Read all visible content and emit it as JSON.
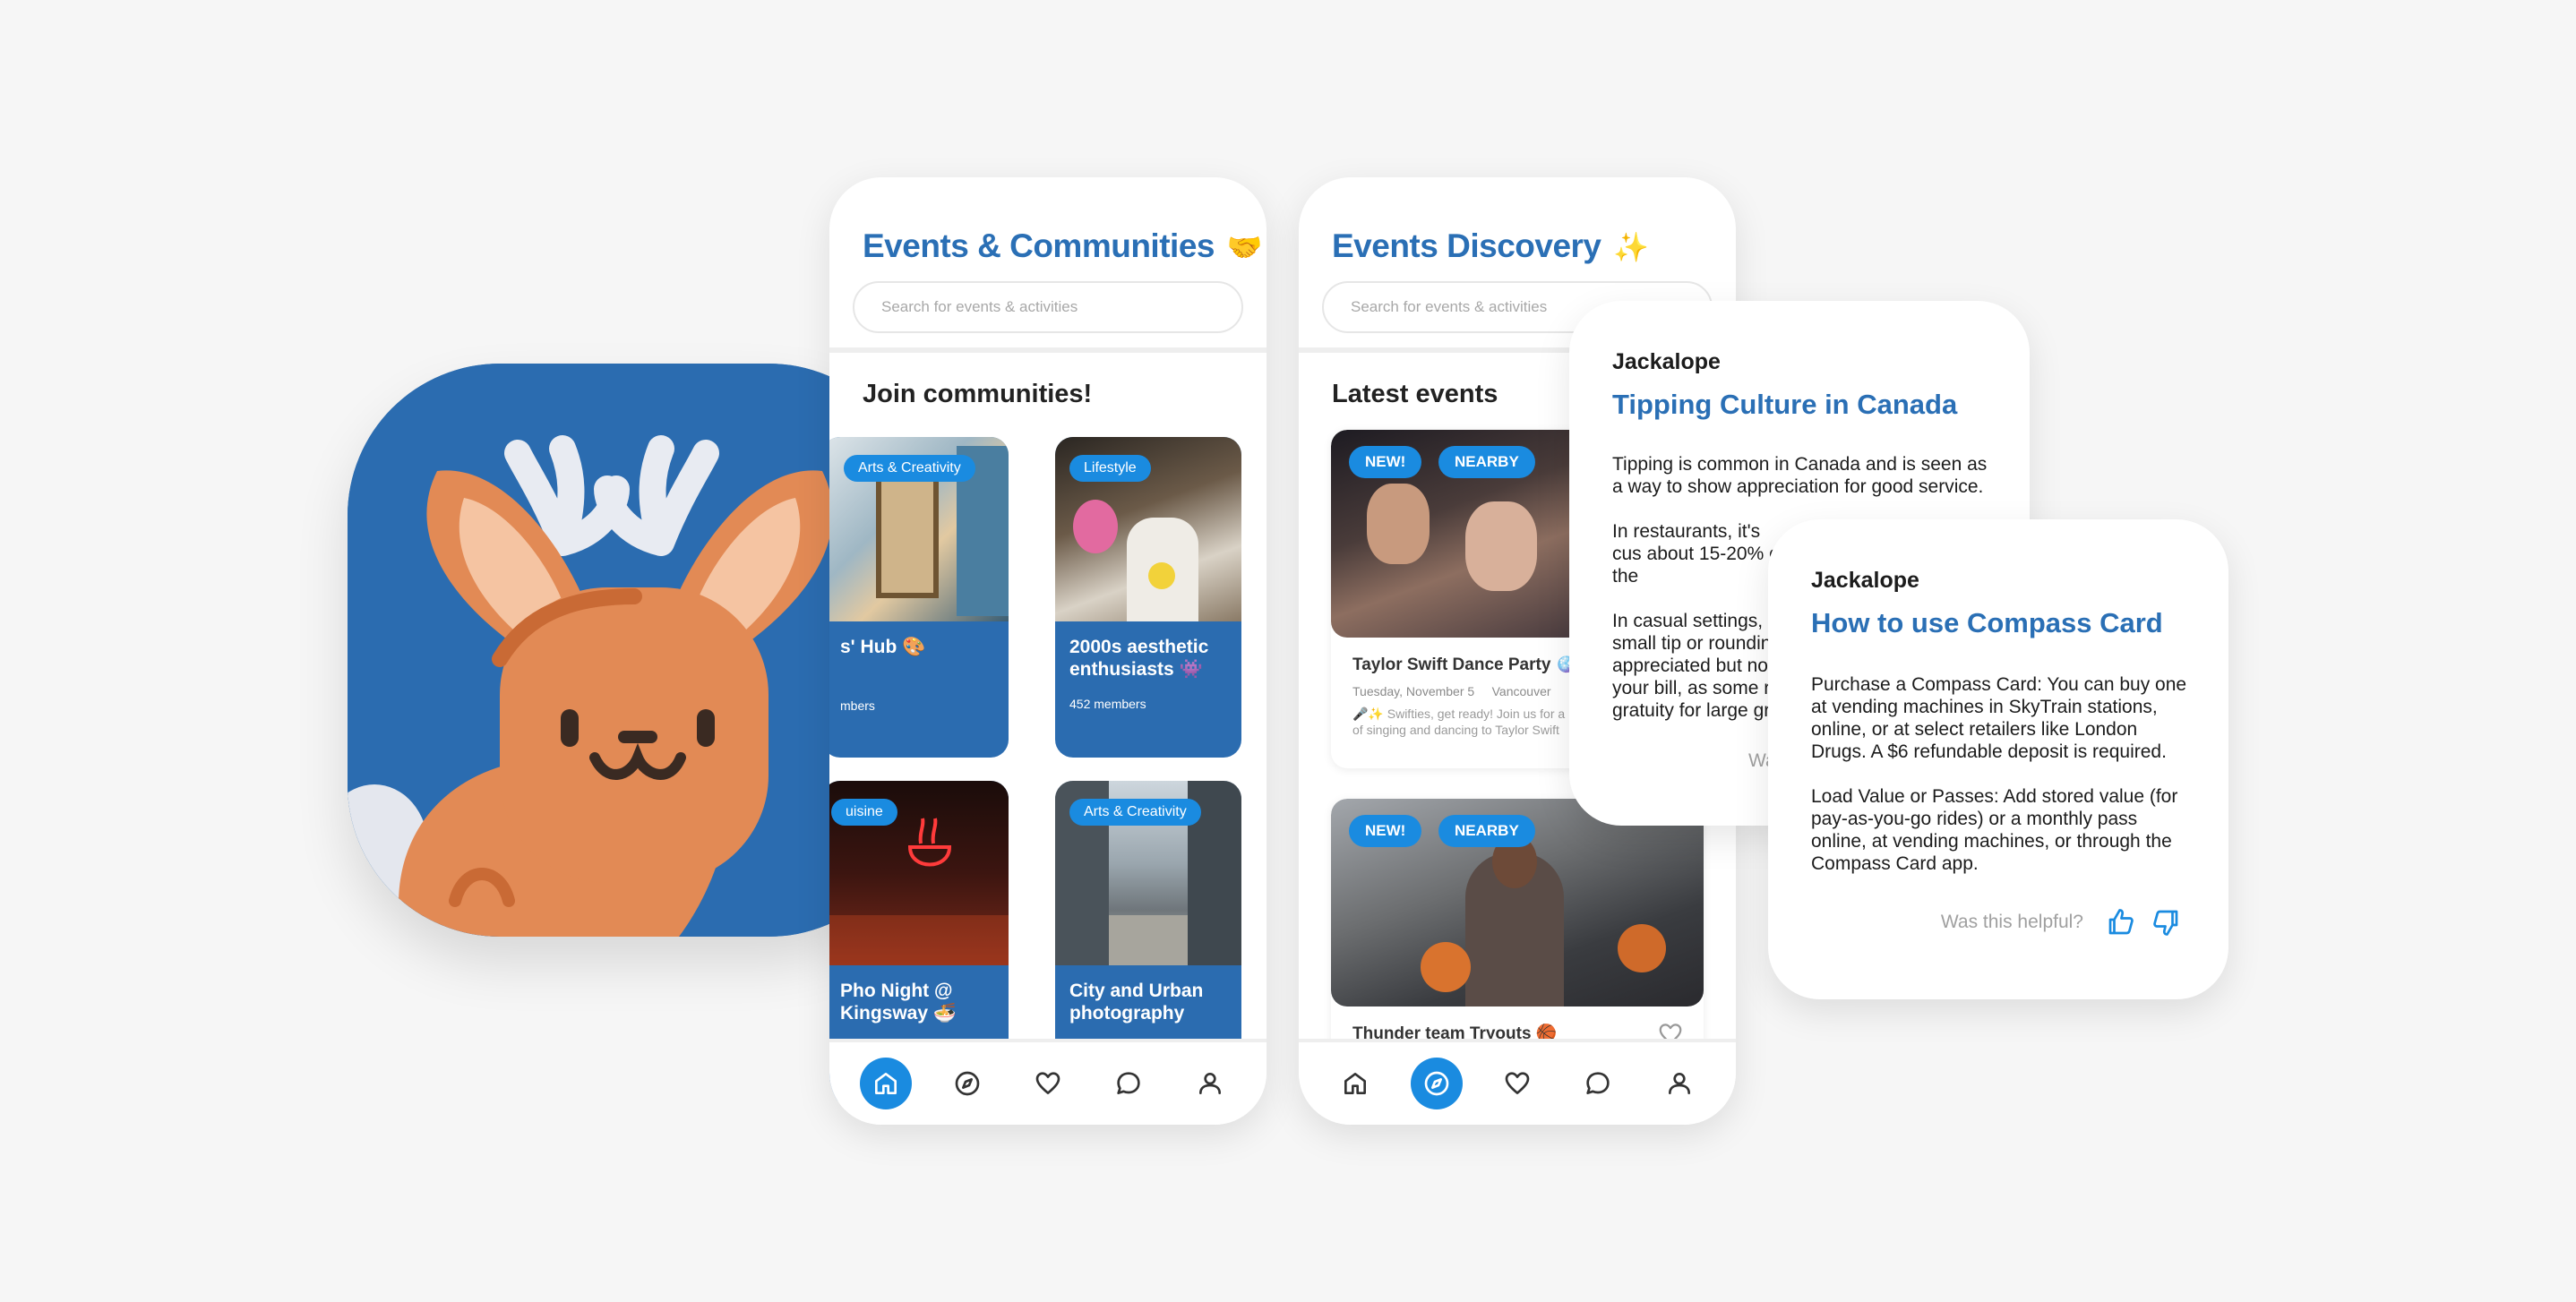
{
  "colors": {
    "brand_blue": "#2a6fb5",
    "accent_blue": "#1a8be0",
    "tile_blue": "#2b6cb0",
    "background": "#f6f6f6"
  },
  "app_icon": {
    "name": "jackalope-mascot-icon"
  },
  "phone1": {
    "title": "Events & Communities",
    "title_emoji": "🤝",
    "search_placeholder": "Search for events & activities",
    "section_title": "Join communities!",
    "tiles": [
      {
        "tag": "Arts & Creativity",
        "name": "s' Hub 🎨",
        "members": "mbers"
      },
      {
        "tag": "Lifestyle",
        "name": "2000s aesthetic enthusiasts 👾",
        "members": "452 members"
      },
      {
        "tag": "uisine",
        "name": "Pho Night @ Kingsway 🍜",
        "members": ""
      },
      {
        "tag": "Arts & Creativity",
        "name": "City and Urban photography",
        "members": ""
      }
    ],
    "nav": [
      "home-icon",
      "compass-icon",
      "heart-icon",
      "chat-icon",
      "profile-icon"
    ],
    "active_nav": "home-icon"
  },
  "phone2": {
    "title": "Events Discovery",
    "title_emoji": "✨",
    "search_placeholder": "Search for events & activities",
    "section_title": "Latest events",
    "events": [
      {
        "badges": [
          "NEW!",
          "NEARBY"
        ],
        "title": "Taylor Swift Dance Party 🪩",
        "date": "Tuesday, November 5",
        "location": "Vancouver",
        "desc": "🎤✨ Swifties, get ready! Join us for a",
        "desc2": "of singing and dancing to Taylor Swift"
      },
      {
        "badges": [
          "NEW!",
          "NEARBY"
        ],
        "title": "Thunder team Tryouts 🏀"
      }
    ],
    "nav": [
      "home-icon",
      "compass-icon",
      "heart-icon",
      "chat-icon",
      "profile-icon"
    ],
    "active_nav": "compass-icon"
  },
  "chat1": {
    "brand": "Jackalope",
    "title": "Tipping Culture in Canada",
    "paragraphs": [
      "Tipping is common in Canada and is seen as a way to show appreciation for good service.",
      "In restaurants, it's cus about 15-20% of the",
      "In casual settings, lik small tip or rounding appreciated but not your bill, as some re gratuity for large gro"
    ],
    "partial_helpful": "Wa"
  },
  "chat2": {
    "brand": "Jackalope",
    "title": "How to use Compass Card",
    "paragraphs": [
      "Purchase a Compass Card: You can buy one at vending machines in SkyTrain stations, online, or at select retailers like London Drugs. A $6 refundable deposit is required.",
      "Load Value or Passes: Add stored value (for pay-as-you-go rides) or a monthly pass online, at vending machines, or through the Compass Card app."
    ],
    "helpful_label": "Was this helpful?"
  }
}
